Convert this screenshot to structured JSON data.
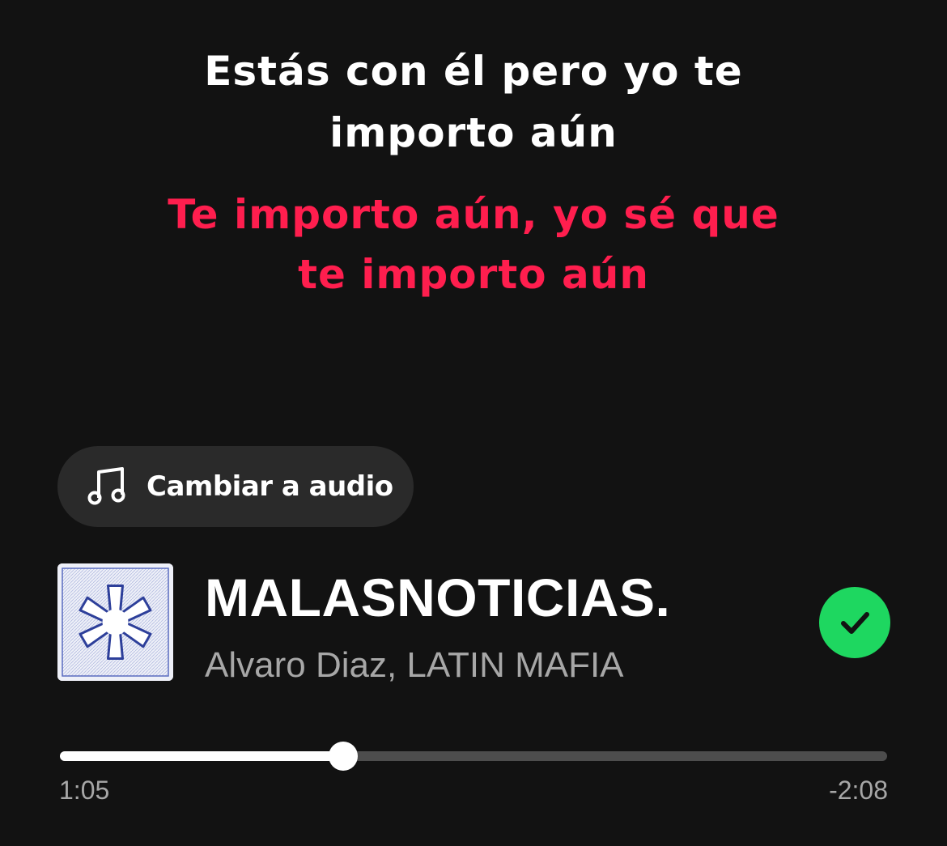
{
  "lyrics": {
    "past_line": "Estás con él pero yo te importo aún",
    "current_line": "Te importo aún, yo sé que te importo aún",
    "current_color": "#ff1e4e"
  },
  "switch_button": {
    "label": "Cambiar a audio",
    "icon": "music-note-icon"
  },
  "track": {
    "title": "MALASNOTICIAS.",
    "artists": "Alvaro Diaz, LATIN MAFIA",
    "cover_icon": "asterisk-star-icon",
    "saved": true,
    "saved_color": "#1ed760"
  },
  "playback": {
    "elapsed": "1:05",
    "remaining": "-2:08",
    "progress_fraction": 0.342
  }
}
